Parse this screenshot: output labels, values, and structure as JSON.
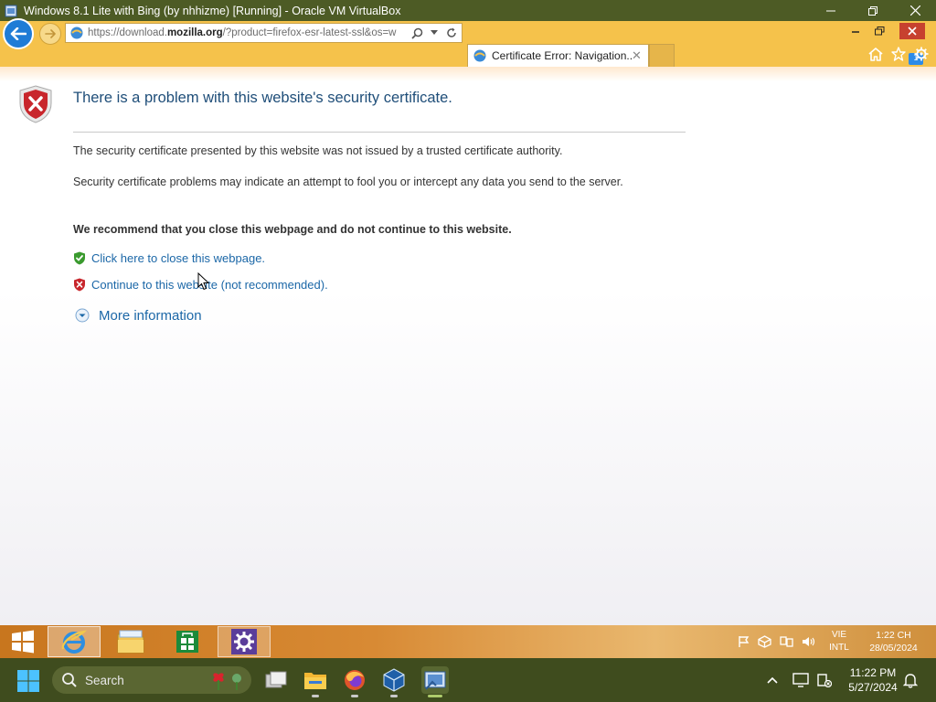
{
  "host_window": {
    "title": "Windows 8.1 Lite with Bing (by nhhizme) [Running] - Oracle VM VirtualBox"
  },
  "browser": {
    "address": {
      "url_prefix": "https://download.",
      "url_domain": "mozilla.org",
      "url_suffix": "/?product=firefox-esr-latest-ssl&os=w"
    },
    "tab": {
      "label": "Certificate Error: Navigation...",
      "close_glyph": "✕"
    },
    "notification_badge": "1"
  },
  "page": {
    "title": "There is a problem with this website's security certificate.",
    "paragraph1": "The security certificate presented by this website was not issued by a trusted certificate authority.",
    "paragraph2": "Security certificate problems may indicate an attempt to fool you or intercept any data you send to the server.",
    "recommendation": "We recommend that you close this webpage and do not continue to this website.",
    "close_link": "Click here to close this webpage.",
    "continue_link": "Continue to this website (not recommended).",
    "more_info": "More information"
  },
  "guest_taskbar": {
    "language": [
      "VIE",
      "INTL"
    ],
    "time": "1:22 CH",
    "date": "28/05/2024"
  },
  "host_taskbar": {
    "search_label": "Search",
    "time": "11:22 PM",
    "date": "5/27/2024"
  },
  "colors": {
    "ie_frame": "#f5c24b",
    "link": "#1b67a7",
    "title_blue": "#1f4e79",
    "host_taskbar": "#3f4c1e",
    "guest_taskbar": "#d88a34"
  }
}
